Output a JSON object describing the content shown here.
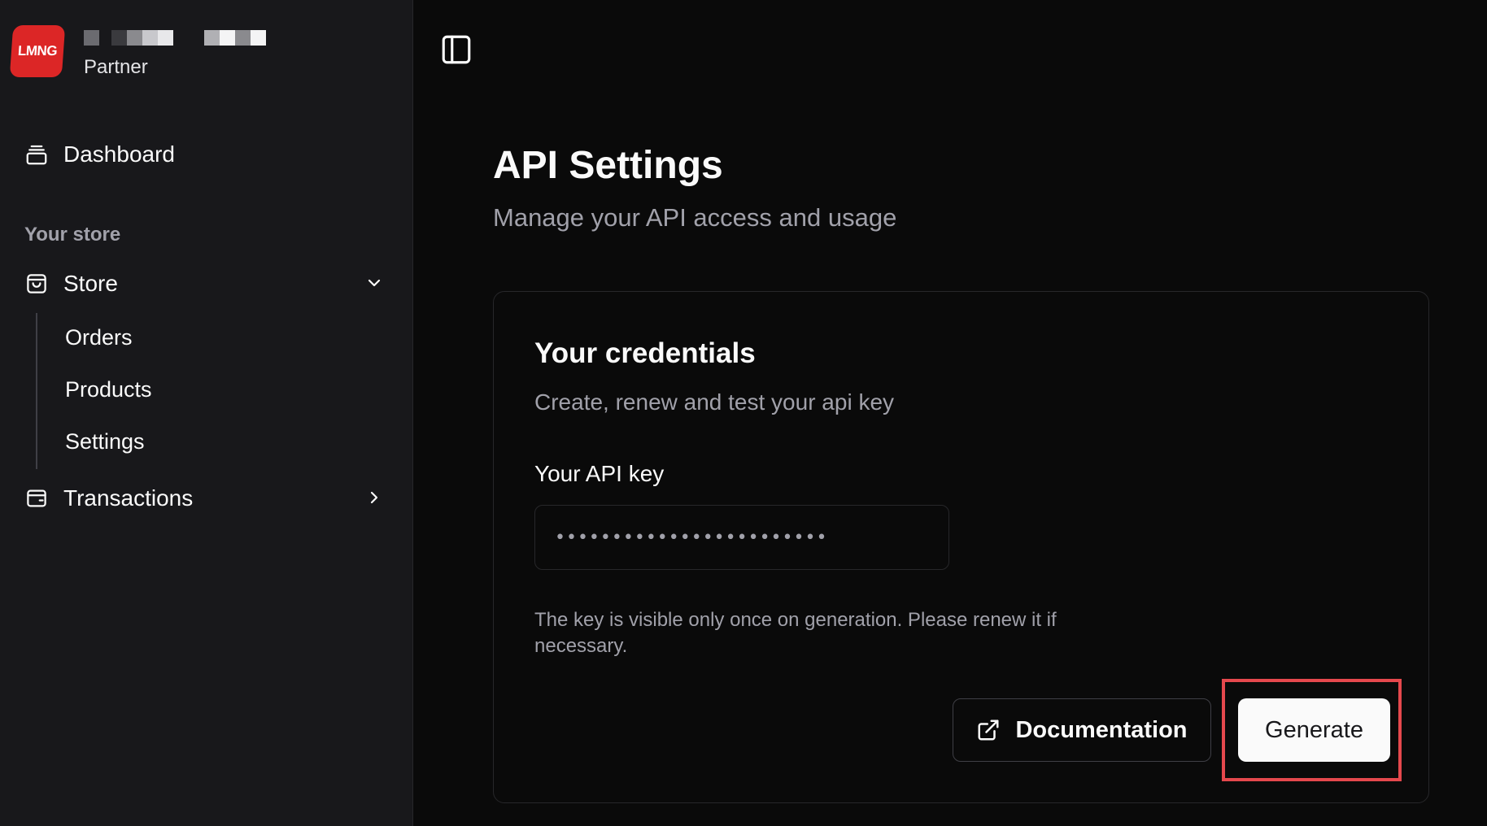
{
  "brand": {
    "logo_text": "LMNG",
    "subtitle": "Partner",
    "name_redacted": "redacted",
    "accent": "#dc2626"
  },
  "sidebar": {
    "dashboard": {
      "label": "Dashboard",
      "icon": "stack-icon"
    },
    "section_label": "Your store",
    "store": {
      "label": "Store",
      "icon": "shopping-bag-icon",
      "expanded": true
    },
    "store_children": [
      {
        "label": "Orders"
      },
      {
        "label": "Products"
      },
      {
        "label": "Settings"
      }
    ],
    "transactions": {
      "label": "Transactions",
      "icon": "wallet-icon",
      "expanded": false
    }
  },
  "header": {
    "toggle_icon": "sidebar-toggle-icon"
  },
  "main": {
    "title": "API Settings",
    "subtitle": "Manage your API access and usage",
    "card": {
      "title": "Your credentials",
      "subtitle": "Create, renew and test your api key",
      "field_label": "Your API key",
      "api_key_value": "••••••••••••••••••••••••",
      "hint": "The key is visible only once on generation. Please renew it if necessary.",
      "documentation_label": "Documentation",
      "documentation_icon": "external-link-icon",
      "generate_label": "Generate",
      "highlight_color": "#e5484d"
    }
  }
}
